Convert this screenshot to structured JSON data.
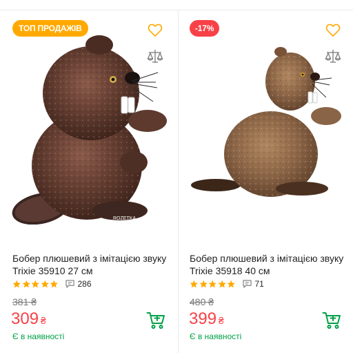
{
  "products": [
    {
      "badge": "ТОП ПРОДАЖІВ",
      "badge_color": "#ffa900",
      "image_icon": "beaver-plush-photo",
      "watermark": "ROZETKA",
      "title": "Бобер плюшевий з імітацією звуку Trixie 35910 27 см",
      "rating_stars": 5,
      "reviews_count": "286",
      "old_price": "381 ₴",
      "price": "309",
      "currency": "₴",
      "availability": "Є в наявності"
    },
    {
      "badge": "-17%",
      "badge_color": "#f84147",
      "image_icon": "beaver-plush-photo",
      "title": "Бобер плюшевий з імітацією звуку Trixie 35918 40 см",
      "rating_stars": 5,
      "reviews_count": "71",
      "old_price": "480 ₴",
      "price": "399",
      "currency": "₴",
      "availability": "Є в наявності"
    }
  ],
  "colors": {
    "price": "#f84147",
    "availability": "#00a046",
    "star": "#ffa900",
    "favorite_icon": "#ffa900",
    "cart_icon": "#00a046"
  }
}
